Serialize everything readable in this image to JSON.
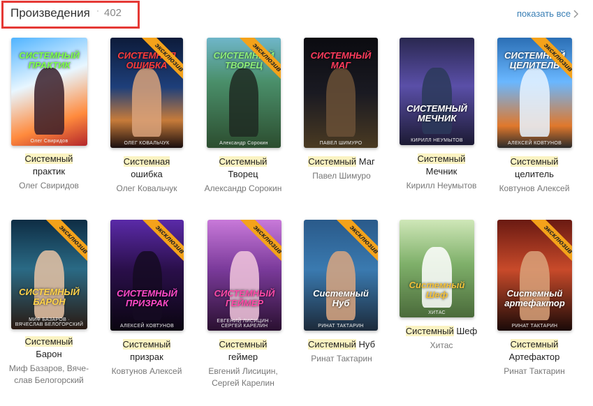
{
  "header": {
    "title": "Произведения",
    "separator": "·",
    "count": "402",
    "show_all": "показать все",
    "accent": "#e53935",
    "link_color": "#3a7fb5"
  },
  "ribbon_label": "эксклюзив",
  "books": [
    {
      "highlight": "Системный",
      "title_rest": "практик",
      "author": "Олег Свиридов",
      "cover_title": "СИСТЕМНЫЙ ПРАКТИК",
      "cover_author": "Олег Свиридов",
      "exclusive": false
    },
    {
      "highlight": "Системная",
      "title_rest": "ошибка",
      "author": "Олег Ковальчук",
      "cover_title": "СИСТЕМНАЯ ОШИБКА",
      "cover_author": "ОЛЕГ КОВАЛЬЧУК",
      "exclusive": true
    },
    {
      "highlight": "Системный",
      "title_rest": "Творец",
      "author": "Александр Сорокин",
      "cover_title": "СИСТЕМНЫЙ ТВОРЕЦ",
      "cover_author": "Александр Сорокин",
      "exclusive": true
    },
    {
      "highlight": "Системный",
      "title_rest": "Маг",
      "author": "Павел Шимуро",
      "cover_title": "СИСТЕМНЫЙ МАГ",
      "cover_author": "ПАВЕЛ ШИМУРО",
      "exclusive": false
    },
    {
      "highlight": "Системный",
      "title_rest": "Мечник",
      "author": "Кирилл Неумытов",
      "cover_title": "СИСТЕМНЫЙ МЕЧНИК",
      "cover_author": "КИРИЛЛ НЕУМЫТОВ",
      "exclusive": false
    },
    {
      "highlight": "Системный",
      "title_rest": "целитель",
      "author": "Ковтунов Алексей",
      "cover_title": "СИСТЕМНЫЙ ЦЕЛИТЕЛЬ",
      "cover_author": "АЛЕКСЕЙ КОВТУНОВ",
      "exclusive": true
    },
    {
      "highlight": "Системный",
      "title_rest": "Барон",
      "author": "Миф Базаров, Вяче­слав Белогорский",
      "cover_title": "СИСТЕМНЫЙ БАРОН",
      "cover_author": "МИФ БАЗАРОВ · ВЯЧЕСЛАВ БЕЛОГОРСКИЙ",
      "exclusive": true
    },
    {
      "highlight": "Системный",
      "title_rest": "призрак",
      "author": "Ковтунов Алексей",
      "cover_title": "СИСТЕМНЫЙ ПРИЗРАК",
      "cover_author": "АЛЕКСЕЙ КОВТУНОВ",
      "exclusive": true
    },
    {
      "highlight": "Системный",
      "title_rest": "геймер",
      "author": "Евгений Лисицин, Сергей Карелин",
      "cover_title": "СИСТЕМНЫЙ ГЕЙМЕР",
      "cover_author": "ЕВГЕНИЙ ЛИСИЦИН · СЕРГЕЙ КАРЕЛИН",
      "exclusive": true
    },
    {
      "highlight": "Системный",
      "title_rest": "Нуб",
      "author": "Ринат Тактарин",
      "cover_title": "Системный Нуб",
      "cover_author": "РИНАТ ТАКТАРИН",
      "exclusive": true
    },
    {
      "highlight": "Системный",
      "title_rest": "Шеф",
      "author": "Хитас",
      "cover_title": "Системный Шеф",
      "cover_author": "ХИТАС",
      "exclusive": false
    },
    {
      "highlight": "Системный",
      "title_rest": "Артефактор",
      "author": "Ринат Тактарин",
      "cover_title": "Системный артефактор",
      "cover_author": "РИНАТ ТАКТАРИН",
      "exclusive": true
    }
  ],
  "cover_palettes": [
    {
      "bg": "linear-gradient(160deg,#4fb3ff 0%,#e8f6ff 40%,#ff8a3d 75%,#b3262b 100%)",
      "title_color": "#7dff4a",
      "figure": "#3a1f2a"
    },
    {
      "bg": "linear-gradient(180deg,#0d1b3a 0%,#1e3f7a 45%,#c77b3a 75%,#1a0e0e 100%)",
      "title_color": "#ff3b3b",
      "figure": "#d9a27a"
    },
    {
      "bg": "linear-gradient(180deg,#6fb6c9 0%,#4a8f6a 40%,#2c4d2f 100%)",
      "title_color": "#8ff07a",
      "figure": "#1e2a22"
    },
    {
      "bg": "linear-gradient(180deg,#0b0b10 0%,#1a1a22 50%,#4a3a22 100%)",
      "title_color": "#ff3b5c",
      "figure": "#6a5036"
    },
    {
      "bg": "linear-gradient(180deg,#2a2850 0%,#5a4fa8 45%,#1c1a33 100%)",
      "title_color": "#ffffff",
      "figure": "#2c3a5a"
    },
    {
      "bg": "linear-gradient(180deg,#2b6fb5 0%,#6ab7ff 40%,#e0782c 80%,#2a2a2a 100%)",
      "title_color": "#ffffff",
      "figure": "#e8f3ff"
    },
    {
      "bg": "linear-gradient(180deg,#0e2d44 0%,#2a6a85 45%,#2a1a12 100%)",
      "title_color": "#ffd34a",
      "figure": "#e8c3a5"
    },
    {
      "bg": "linear-gradient(180deg,#5a2aa8 0%,#2a0f4a 45%,#0a0510 100%)",
      "title_color": "#ff4ac8",
      "figure": "#150a22"
    },
    {
      "bg": "linear-gradient(180deg,#c879d9 0%,#7a3a9a 45%,#2a1030 100%)",
      "title_color": "#ff4aa8",
      "figure": "#f2c7dd"
    },
    {
      "bg": "linear-gradient(180deg,#2a5a8a 0%,#3a7ab0 45%,#1c2a3a 100%)",
      "title_color": "#ffffff",
      "figure": "#d9a680"
    },
    {
      "bg": "linear-gradient(180deg,#cfe7b8 0%,#7fb06a 45%,#4a6a3a 100%)",
      "title_color": "#f4c23a",
      "figure": "#ffffff"
    },
    {
      "bg": "linear-gradient(180deg,#6a1a12 0%,#c84a2a 45%,#1a0a08 100%)",
      "title_color": "#ffffff",
      "figure": "#d9a27a"
    }
  ]
}
